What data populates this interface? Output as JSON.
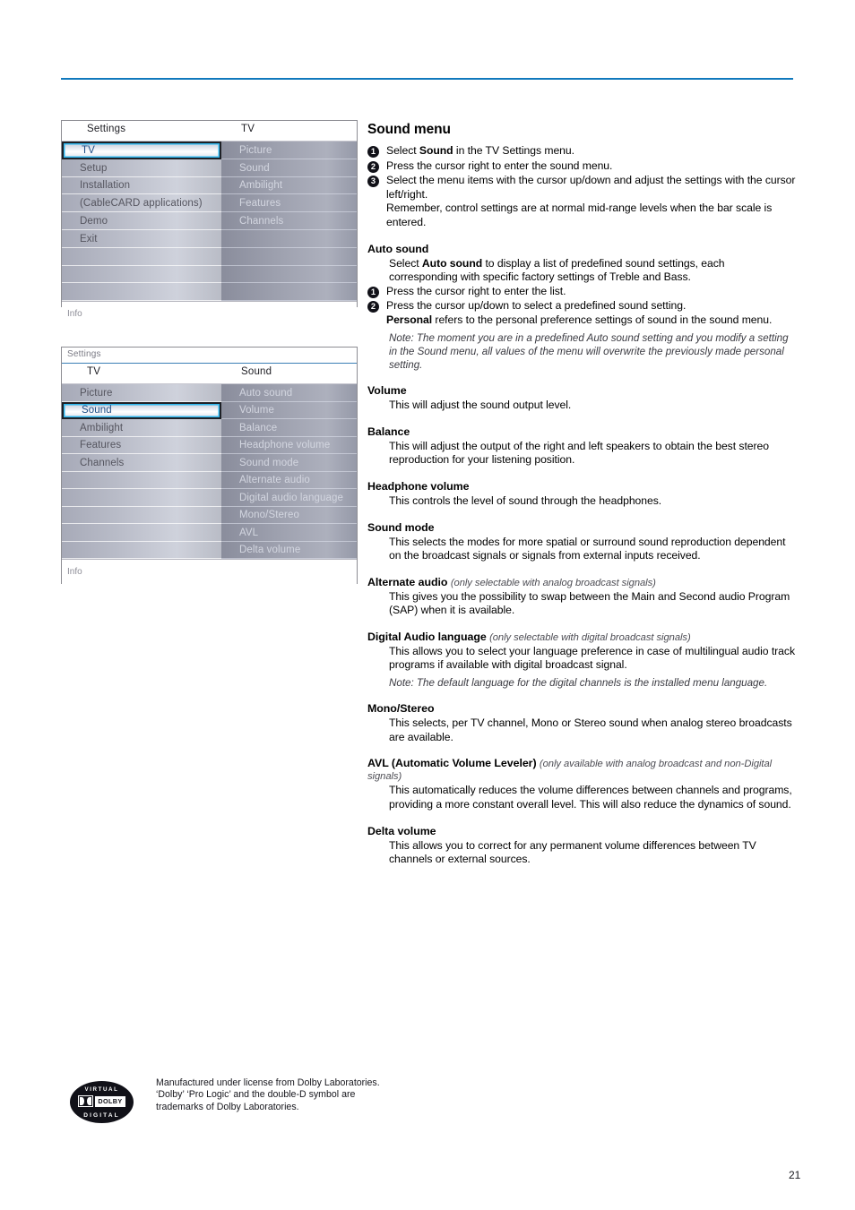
{
  "page": {
    "number": "21",
    "rule_color": "#1079bd"
  },
  "osd_menu_1": {
    "name": "tv-settings-menu",
    "header_left": "Settings",
    "header_right": "TV",
    "left_items": [
      "TV",
      "Setup",
      "Installation",
      "(CableCARD applications)",
      "Demo",
      "Exit",
      "",
      "",
      ""
    ],
    "left_selected_index": 0,
    "right_items": [
      "Picture",
      "Sound",
      "Ambilight",
      "Features",
      "Channels",
      "",
      "",
      "",
      ""
    ],
    "info_label": "Info"
  },
  "osd_menu_2": {
    "name": "sound-settings-menu",
    "breadcrumb": "Settings",
    "header_left": "TV",
    "header_right": "Sound",
    "left_items": [
      "Picture",
      "Sound",
      "Ambilight",
      "Features",
      "Channels",
      "",
      "",
      "",
      "",
      ""
    ],
    "left_selected_index": 1,
    "right_items": [
      "Auto sound",
      "Volume",
      "Balance",
      "Headphone volume",
      "Sound mode",
      "Alternate audio",
      "Digital audio language",
      "Mono/Stereo",
      "AVL",
      "Delta volume"
    ],
    "info_label": "Info"
  },
  "article": {
    "title": "Sound menu",
    "steps_intro": [
      {
        "num": "1",
        "html": "Select <b>Sound</b> in the TV Settings menu."
      },
      {
        "num": "2",
        "html": "Press the cursor right to enter the sound menu."
      },
      {
        "num": "3",
        "html": "Select the menu items with the cursor up/down and adjust the settings with the cursor left/right.<br>Remember, control settings are at normal mid-range levels when the bar scale is entered."
      }
    ],
    "sections": [
      {
        "heading": "Auto sound",
        "qualifier": "",
        "body_html": "Select <b>Auto sound</b> to display a list of predefined sound settings, each corresponding with specific factory settings of Treble and Bass.",
        "steps": [
          {
            "num": "1",
            "html": "Press the cursor right to enter the list."
          },
          {
            "num": "2",
            "html": "Press the cursor up/down to select a predefined sound setting.<br><b>Personal</b> refers to the personal preference settings of sound in the sound menu."
          }
        ],
        "note": "Note: The moment you are in a predefined Auto sound setting and you modify a setting in the Sound menu, all values of the menu will overwrite the previously made personal setting."
      },
      {
        "heading": "Volume",
        "qualifier": "",
        "body_html": "This will adjust the sound output level.",
        "steps": [],
        "note": ""
      },
      {
        "heading": "Balance",
        "qualifier": "",
        "body_html": "This will adjust the output of the right and left speakers to obtain the best stereo reproduction for your listening position.",
        "steps": [],
        "note": ""
      },
      {
        "heading": "Headphone volume",
        "qualifier": "",
        "body_html": "This controls the level of sound through the headphones.",
        "steps": [],
        "note": ""
      },
      {
        "heading": "Sound mode",
        "qualifier": "",
        "body_html": "This selects the modes for more spatial or surround sound reproduction dependent on the broadcast signals or signals from external inputs received.",
        "steps": [],
        "note": ""
      },
      {
        "heading": "Alternate audio",
        "qualifier": "(only selectable with analog broadcast signals)",
        "body_html": "This gives you the possibility to swap between the Main and Second audio Program (SAP) when it is available.",
        "steps": [],
        "note": ""
      },
      {
        "heading": "Digital Audio language",
        "qualifier": "(only selectable with digital broadcast signals)",
        "body_html": "This allows you to select your language preference in case of multilingual audio track programs if available with digital broadcast signal.",
        "steps": [],
        "note": "Note: The default language for the digital channels is the installed menu language."
      },
      {
        "heading": "Mono/Stereo",
        "qualifier": "",
        "body_html": "This selects, per TV channel, Mono or Stereo sound when analog stereo broadcasts are available.",
        "steps": [],
        "note": ""
      },
      {
        "heading": "AVL (Automatic Volume Leveler)",
        "qualifier": "(only available with analog broadcast and non-Digital signals)",
        "body_html": "This automatically reduces the volume differences between channels and programs, providing a more constant overall level. This will also reduce the dynamics of sound.",
        "steps": [],
        "note": ""
      },
      {
        "heading": "Delta volume",
        "qualifier": "",
        "body_html": "This allows you to correct for any permanent volume differences between TV channels or external sources.",
        "steps": [],
        "note": ""
      }
    ]
  },
  "footer": {
    "logo": {
      "top_text": "VIRTUAL",
      "word": "DOLBY",
      "bottom_text": "DIGITAL"
    },
    "text_lines": [
      "Manufactured under license from Dolby Laboratories.",
      "‘Dolby’ ‘Pro Logic’ and the double-D symbol are",
      "trademarks of Dolby Laboratories."
    ]
  }
}
